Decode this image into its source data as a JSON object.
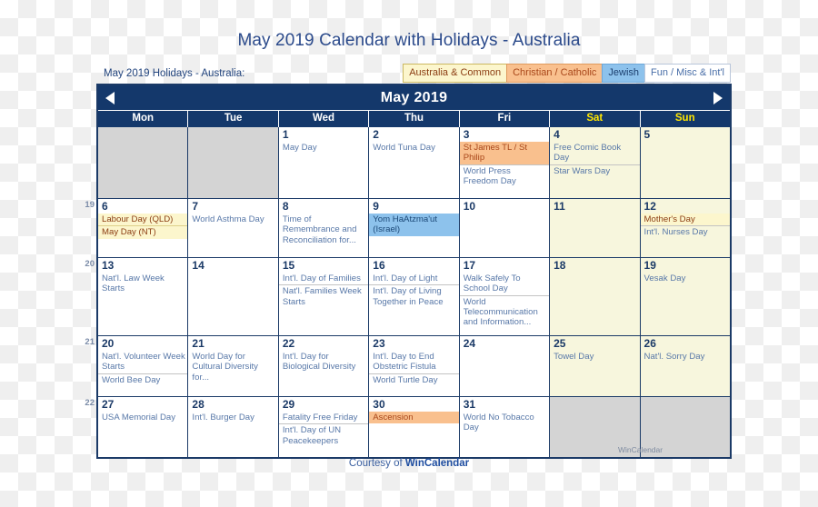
{
  "page_title": "May 2019 Calendar with Holidays - Australia",
  "legend": {
    "label": "May 2019 Holidays - Australia:",
    "chips": [
      {
        "text": "Australia & Common",
        "kind": "aus",
        "color": "#fcf6cd"
      },
      {
        "text": "Christian / Catholic",
        "kind": "chr",
        "color": "#f9c08e"
      },
      {
        "text": "Jewish",
        "kind": "jew",
        "color": "#8dc2ec"
      },
      {
        "text": "Fun / Misc & Int'l",
        "kind": "fun",
        "color": "#ffffff"
      }
    ]
  },
  "calendar": {
    "title": "May 2019",
    "prev_icon": "triangle-left-icon",
    "next_icon": "triangle-right-icon",
    "day_names": [
      "Mon",
      "Tue",
      "Wed",
      "Thu",
      "Fri",
      "Sat",
      "Sun"
    ],
    "watermark": "WinCalendar",
    "weeks": [
      {
        "week_number": "",
        "days": [
          {
            "num": "",
            "blank": true,
            "events": []
          },
          {
            "num": "",
            "blank": true,
            "events": []
          },
          {
            "num": "1",
            "events": [
              {
                "text": "May Day",
                "kind": "fun"
              }
            ]
          },
          {
            "num": "2",
            "events": [
              {
                "text": "World Tuna Day",
                "kind": "fun"
              }
            ]
          },
          {
            "num": "3",
            "events": [
              {
                "text": "St James TL / St Philip",
                "kind": "chr"
              },
              {
                "text": "World Press Freedom Day",
                "kind": "fun"
              }
            ]
          },
          {
            "num": "4",
            "weekend": true,
            "events": [
              {
                "text": "Free Comic Book Day",
                "kind": "fun"
              },
              {
                "text": "Star Wars Day",
                "kind": "fun"
              }
            ]
          },
          {
            "num": "5",
            "weekend": true,
            "events": []
          }
        ]
      },
      {
        "week_number": "19",
        "days": [
          {
            "num": "6",
            "events": [
              {
                "text": "Labour Day (QLD)",
                "kind": "aus"
              },
              {
                "text": "May Day (NT)",
                "kind": "aus"
              }
            ]
          },
          {
            "num": "7",
            "events": [
              {
                "text": "World Asthma Day",
                "kind": "fun"
              }
            ]
          },
          {
            "num": "8",
            "events": [
              {
                "text": "Time of Remembrance and Reconciliation for...",
                "kind": "fun"
              }
            ]
          },
          {
            "num": "9",
            "events": [
              {
                "text": "Yom HaAtzma'ut (Israel)",
                "kind": "jew"
              }
            ]
          },
          {
            "num": "10",
            "events": []
          },
          {
            "num": "11",
            "weekend": true,
            "events": []
          },
          {
            "num": "12",
            "weekend": true,
            "events": [
              {
                "text": "Mother's Day",
                "kind": "aus"
              },
              {
                "text": "Int'l. Nurses Day",
                "kind": "fun"
              }
            ]
          }
        ]
      },
      {
        "week_number": "20",
        "days": [
          {
            "num": "13",
            "events": [
              {
                "text": "Nat'l. Law Week Starts",
                "kind": "fun"
              }
            ]
          },
          {
            "num": "14",
            "events": []
          },
          {
            "num": "15",
            "events": [
              {
                "text": "Int'l. Day of Families",
                "kind": "fun"
              },
              {
                "text": "Nat'l. Families Week Starts",
                "kind": "fun"
              }
            ]
          },
          {
            "num": "16",
            "events": [
              {
                "text": "Int'l. Day of Light",
                "kind": "fun"
              },
              {
                "text": "Int'l. Day of Living Together in Peace",
                "kind": "fun"
              }
            ]
          },
          {
            "num": "17",
            "events": [
              {
                "text": "Walk Safely To School Day",
                "kind": "fun"
              },
              {
                "text": "World Telecommunication and Information...",
                "kind": "fun"
              }
            ]
          },
          {
            "num": "18",
            "weekend": true,
            "events": []
          },
          {
            "num": "19",
            "weekend": true,
            "events": [
              {
                "text": "Vesak Day",
                "kind": "fun"
              }
            ]
          }
        ]
      },
      {
        "week_number": "21",
        "days": [
          {
            "num": "20",
            "events": [
              {
                "text": "Nat'l. Volunteer Week Starts",
                "kind": "fun"
              },
              {
                "text": "World Bee Day",
                "kind": "fun"
              }
            ]
          },
          {
            "num": "21",
            "events": [
              {
                "text": "World Day for Cultural Diversity for...",
                "kind": "fun"
              }
            ]
          },
          {
            "num": "22",
            "events": [
              {
                "text": "Int'l. Day for Biological Diversity",
                "kind": "fun"
              }
            ]
          },
          {
            "num": "23",
            "events": [
              {
                "text": "Int'l. Day to End Obstetric Fistula",
                "kind": "fun"
              },
              {
                "text": "World Turtle Day",
                "kind": "fun"
              }
            ]
          },
          {
            "num": "24",
            "events": []
          },
          {
            "num": "25",
            "weekend": true,
            "events": [
              {
                "text": "Towel Day",
                "kind": "fun"
              }
            ]
          },
          {
            "num": "26",
            "weekend": true,
            "events": [
              {
                "text": "Nat'l. Sorry Day",
                "kind": "fun"
              }
            ]
          }
        ]
      },
      {
        "week_number": "22",
        "days": [
          {
            "num": "27",
            "events": [
              {
                "text": "USA Memorial Day",
                "kind": "fun"
              }
            ]
          },
          {
            "num": "28",
            "events": [
              {
                "text": "Int'l. Burger Day",
                "kind": "fun"
              }
            ]
          },
          {
            "num": "29",
            "events": [
              {
                "text": "Fatality Free Friday",
                "kind": "fun"
              },
              {
                "text": "Int'l. Day of UN Peacekeepers",
                "kind": "fun"
              }
            ]
          },
          {
            "num": "30",
            "events": [
              {
                "text": "Ascension",
                "kind": "chr"
              }
            ]
          },
          {
            "num": "31",
            "events": [
              {
                "text": "World No Tobacco Day",
                "kind": "fun"
              }
            ]
          },
          {
            "num": "",
            "blank": true,
            "events": []
          },
          {
            "num": "",
            "blank": true,
            "events": []
          }
        ]
      }
    ]
  },
  "footer": {
    "prefix": "Courtesy of ",
    "brand": "WinCalendar"
  }
}
